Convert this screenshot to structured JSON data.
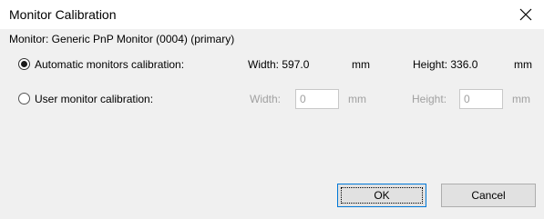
{
  "window": {
    "title": "Monitor Calibration",
    "close_icon": "close-icon"
  },
  "monitor": {
    "label": "Monitor: Generic PnP Monitor (0004) (primary)"
  },
  "automatic": {
    "label": "Automatic monitors calibration:",
    "selected": true,
    "width_text": "Width: 597.0",
    "width_unit": "mm",
    "height_text": "Height: 336.0",
    "height_unit": "mm"
  },
  "user": {
    "label": "User monitor calibration:",
    "selected": false,
    "width_label": "Width:",
    "width_value": "0",
    "width_unit": "mm",
    "height_label": "Height:",
    "height_value": "0",
    "height_unit": "mm"
  },
  "buttons": {
    "ok": "OK",
    "cancel": "Cancel"
  },
  "colors": {
    "background": "#f0f0f0",
    "titlebar": "#ffffff",
    "disabled_text": "#a0a0a0",
    "focus_border": "#0078d7"
  }
}
